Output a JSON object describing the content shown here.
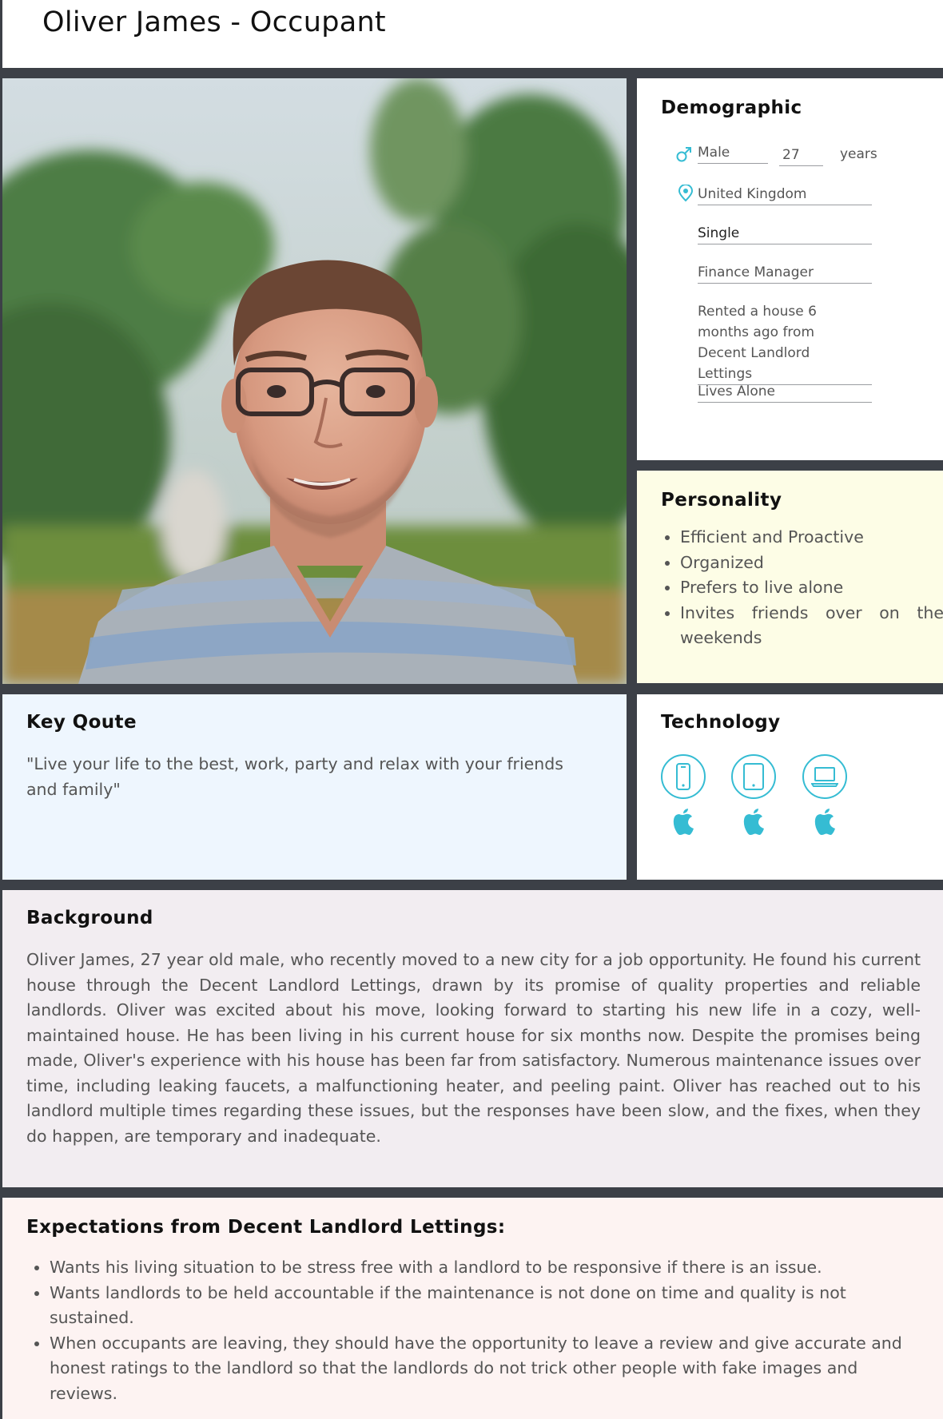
{
  "page_title": "Oliver James - Occupant",
  "photo": {
    "alt": "portrait-photo"
  },
  "demographic": {
    "heading": "Demographic",
    "gender": "Male",
    "age": "27",
    "age_unit": "years",
    "location": "United Kingdom",
    "status": "Single",
    "occupation": "Finance Manager",
    "residence": "Rented a house 6 months ago from Decent Landlord Lettings",
    "household": "Lives Alone",
    "icons": {
      "gender": "male-icon",
      "location": "map-pin-icon"
    },
    "accent": "#35bcd3"
  },
  "personality": {
    "heading": "Personality",
    "traits": [
      "Efficient and Proactive",
      "Organized",
      "Prefers to live alone",
      "Invites friends over on the weekends"
    ]
  },
  "key_quote": {
    "heading": "Key Qoute",
    "text": "\"Live your life to the best, work, party and relax with your friends and family\""
  },
  "technology": {
    "heading": "Technology",
    "devices": [
      {
        "icon": "smartphone-icon",
        "platform": "apple-icon"
      },
      {
        "icon": "tablet-icon",
        "platform": "apple-icon"
      },
      {
        "icon": "laptop-icon",
        "platform": "apple-icon"
      }
    ]
  },
  "background": {
    "heading": "Background",
    "text": "Oliver James, 27 year old male, who recently moved to a new city for a job opportunity. He found his current house through the Decent Landlord Lettings, drawn by its promise of quality properties and reliable landlords. Oliver was excited about his move, looking forward to starting his new life in a cozy, well-maintained house. He has been living in his current house for six months now. Despite the promises being made, Oliver's experience with his house has been far from satisfactory. Numerous maintenance issues over time, including leaking faucets, a malfunctioning heater, and peeling paint. Oliver has reached out to his landlord multiple times regarding these issues, but the responses have been slow, and the fixes, when they do happen, are temporary and inadequate."
  },
  "expectations": {
    "heading": "Expectations from Decent Landlord Lettings:",
    "items": [
      "Wants his living situation to be stress free with a landlord to be responsive if there is an issue.",
      "Wants landlords to be held accountable if the maintenance is not done on time and quality is not sustained.",
      "When occupants are leaving, they should have the opportunity to leave a review and give accurate and honest ratings to the landlord so that the landlords do not trick other people with fake images and reviews."
    ]
  }
}
